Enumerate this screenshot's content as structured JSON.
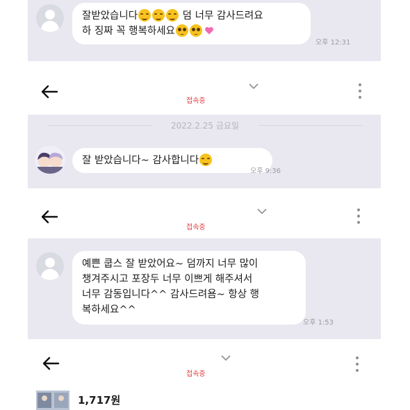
{
  "screenshot1": {
    "message_line1": "잘받았습니다",
    "message_line1_tail": "덤 너무 감사드려요",
    "message_line2": "하 징짜 꼭 행복하세요",
    "time": "오후 12:31"
  },
  "header1": {
    "status": "접속중"
  },
  "screenshot2": {
    "date": "2022.2.25 금요일",
    "message": "잘 받았습니다~ 감사합니다",
    "time": "오후 9:36"
  },
  "header2": {
    "status": "접속중"
  },
  "screenshot3": {
    "message_lines": [
      "예쁜 쿱스 잘 받았어요~ 덤까지 너무 많이",
      "챙겨주시고 포장두 너무 이쁘게 해주셔서",
      "너무 감동입니다^^ 감사드려욤~ 항상 행",
      "복하세요^^"
    ],
    "time": "오후 1:53"
  },
  "header3": {
    "status": "접속중"
  },
  "product": {
    "price": "1,717원"
  },
  "colors": {
    "panel_bg": "#e9e8f0",
    "status_red": "#e23c3c",
    "bubble_bg": "#ffffff"
  }
}
